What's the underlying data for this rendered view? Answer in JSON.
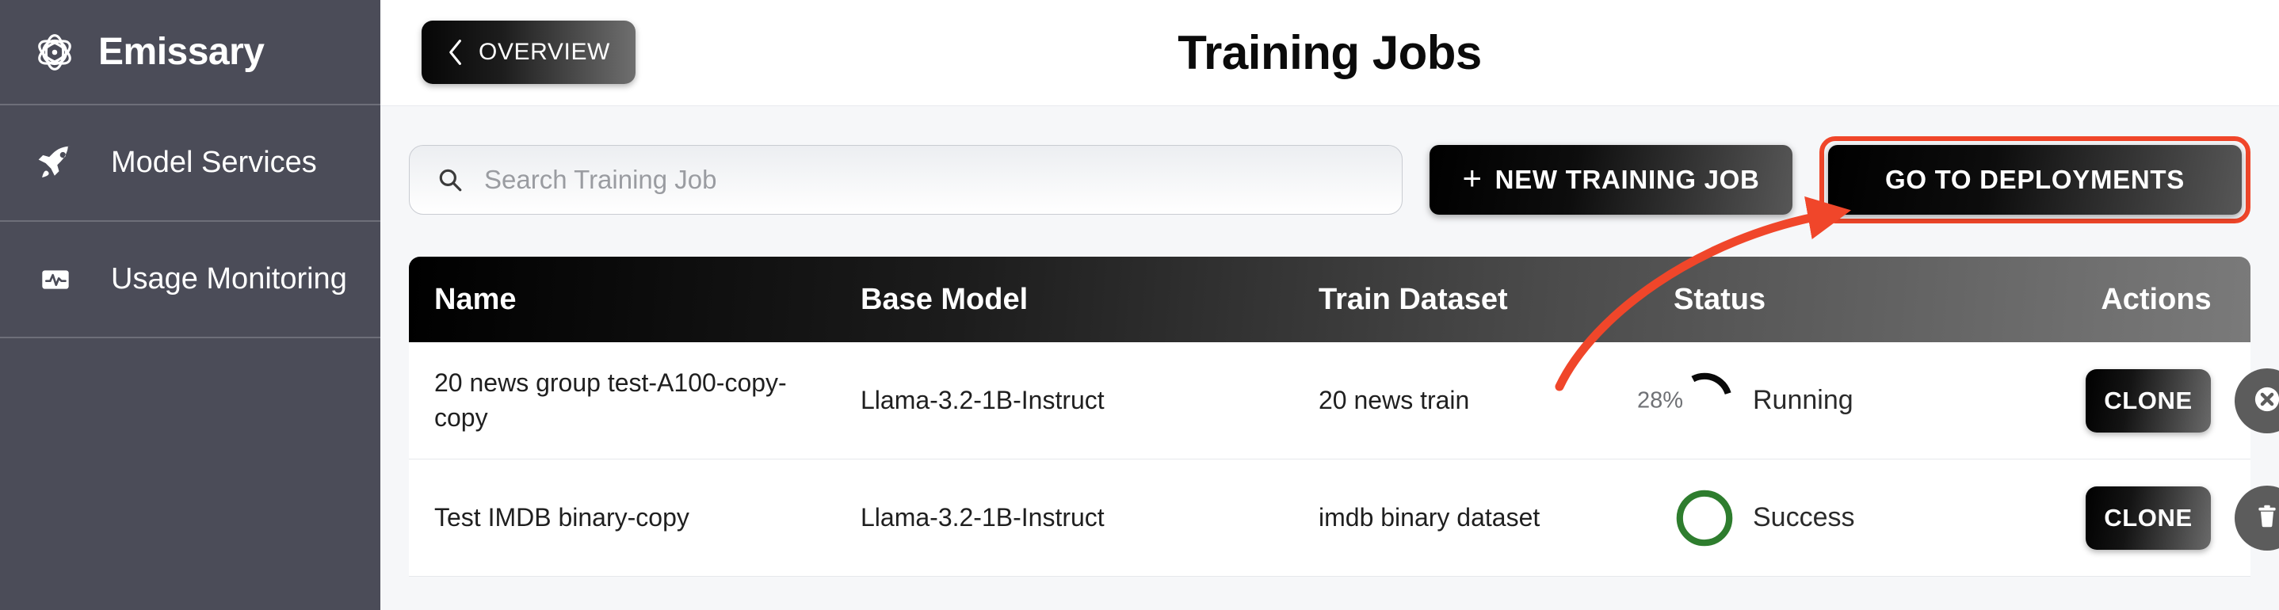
{
  "brand": {
    "name": "Emissary",
    "logo_icon": "atom-icon"
  },
  "sidebar": {
    "items": [
      {
        "label": "Model Services",
        "icon": "rocket-icon"
      },
      {
        "label": "Usage Monitoring",
        "icon": "activity-monitor-icon"
      }
    ]
  },
  "header": {
    "back_button": "OVERVIEW",
    "back_icon": "chevron-left-icon",
    "title": "Training Jobs"
  },
  "toolbar": {
    "search_placeholder": "Search Training Job",
    "search_value": "",
    "search_icon": "search-icon",
    "new_job_label": "NEW TRAINING JOB",
    "new_job_icon": "plus-icon",
    "deployments_label": "GO TO DEPLOYMENTS"
  },
  "table": {
    "columns": [
      "Name",
      "Base Model",
      "Train Dataset",
      "Status",
      "Actions"
    ],
    "rows": [
      {
        "name": "20 news group test-A100-copy-copy",
        "base_model": "Llama-3.2-1B-Instruct",
        "train_dataset": "20 news train",
        "status": "Running",
        "progress": "28%",
        "progress_value": 28,
        "clone_label": "CLONE",
        "secondary_action_icon": "cancel-circle-icon"
      },
      {
        "name": "Test IMDB binary-copy",
        "base_model": "Llama-3.2-1B-Instruct",
        "train_dataset": "imdb binary dataset",
        "status": "Success",
        "progress": "",
        "progress_value": 100,
        "clone_label": "CLONE",
        "secondary_action_icon": "trash-icon"
      }
    ]
  },
  "annotation": {
    "highlight_color": "#f0462a",
    "arrow_target": "GO TO DEPLOYMENTS"
  },
  "colors": {
    "sidebar_bg": "#4b4c58",
    "content_bg": "#f6f7f9",
    "success_green": "#2e7d2e",
    "accent_red": "#f0462a"
  }
}
